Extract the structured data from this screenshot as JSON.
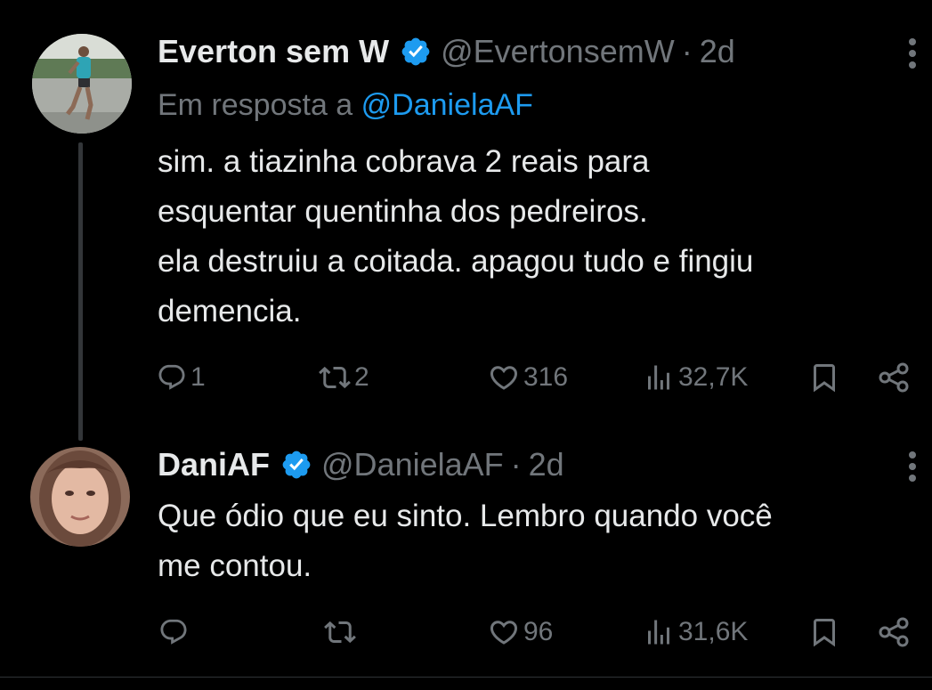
{
  "tweets": [
    {
      "name": "Everton sem W",
      "handle": "@EvertonsemW",
      "separator": "·",
      "time": "2d",
      "replying_prefix": "Em resposta a",
      "replying_to": "@DanielaAF",
      "body": [
        "sim. a tiazinha cobrava 2 reais para",
        "esquentar quentinha dos pedreiros.",
        "ela destruiu a coitada. apagou tudo e fingiu",
        "demencia."
      ],
      "replies": "1",
      "reposts": "2",
      "likes": "316",
      "views": "32,7K"
    },
    {
      "name": "DaniAF",
      "handle": "@DanielaAF",
      "separator": "·",
      "time": "2d",
      "body": [
        "Que ódio que eu sinto. Lembro quando você",
        "me contou."
      ],
      "replies": "",
      "reposts": "",
      "likes": "96",
      "views": "31,6K"
    }
  ],
  "colors": {
    "background": "#000000",
    "text": "#e7e9ea",
    "muted": "#71767b",
    "accent": "#1d9bf0",
    "verified": "#1d9bf0"
  },
  "icons": [
    "verified-badge-icon",
    "more-options-icon",
    "reply-icon",
    "repost-icon",
    "like-icon",
    "views-icon",
    "bookmark-icon",
    "share-icon"
  ]
}
